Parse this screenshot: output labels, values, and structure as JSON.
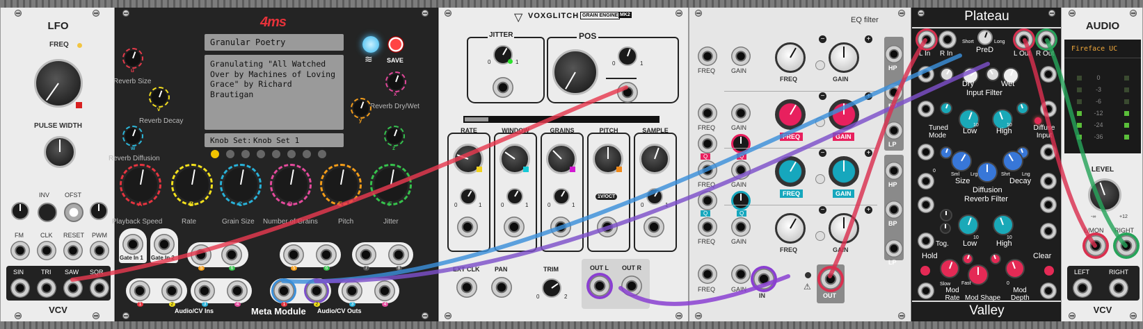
{
  "lfo": {
    "title": "LFO",
    "freq": "FREQ",
    "pulse_width": "PULSE WIDTH",
    "inv": "INV",
    "ofst": "OFST",
    "fm": "FM",
    "clk": "CLK",
    "reset": "RESET",
    "pwm": "PWM",
    "sin": "SIN",
    "tri": "TRI",
    "saw": "SAW",
    "sqr": "SQR",
    "brand": "VCV"
  },
  "metamodule": {
    "logo": "4ms",
    "save": "SAVE",
    "patch_name": "Granular Poetry",
    "description": "Granulating \"All Watched Over by Machines of Loving Grace\" by Richard Brautigan",
    "knobset_label": "Knob Set:",
    "knobset_value": "Knob Set 1",
    "small_knobs": [
      {
        "letter": "u",
        "name": "Reverb Size",
        "color": "#e43a4a"
      },
      {
        "letter": "v",
        "name": "Reverb Decay",
        "color": "#f1dc1e"
      },
      {
        "letter": "w",
        "name": "Reverb Diffusion",
        "color": "#2cb6d9"
      },
      {
        "letter": "x",
        "name": "Reverb Dry/Wet",
        "color": "#e0479a"
      },
      {
        "letter": "y",
        "name": "",
        "color": "#f39c1a"
      },
      {
        "letter": "z",
        "name": "",
        "color": "#35c04e"
      }
    ],
    "big_knobs": [
      {
        "letter": "A",
        "name": "Playback Speed",
        "color": "#e4343f"
      },
      {
        "letter": "B",
        "name": "Rate",
        "color": "#f2e01c"
      },
      {
        "letter": "C",
        "name": "Grain Size",
        "color": "#28b1d8"
      },
      {
        "letter": "D",
        "name": "Number of Grains",
        "color": "#e44a9c"
      },
      {
        "letter": "E",
        "name": "Pitch",
        "color": "#f39c18"
      },
      {
        "letter": "F",
        "name": "Jitter",
        "color": "#36c24c"
      }
    ],
    "gate_in_1": "Gate In 1",
    "gate_in_2": "Gate In 2",
    "audio_cv_ins": "Audio/CV Ins",
    "audio_cv_outs": "Audio/CV Outs",
    "title": "Meta Module",
    "jack_numbers": [
      "1",
      "2",
      "3",
      "4",
      "5",
      "6",
      "7",
      "8"
    ]
  },
  "grain": {
    "brand": "VOXGLITCH",
    "brand_tag": "GRAIN ENGINE",
    "brand_ver": "MK2",
    "jitter": "JITTER",
    "pos": "POS",
    "zero": "0",
    "one": "1",
    "two": "2",
    "rate": "RATE",
    "window": "WINDOW",
    "grains": "GRAINS",
    "pitch": "PITCH",
    "sample": "SAMPLE",
    "voct": "1V/OCT",
    "ext_clk": "EXT CLK",
    "pan": "PAN",
    "trim": "TRIM",
    "out_l": "OUT L",
    "out_r": "OUT R"
  },
  "eq": {
    "title": "EQ filter",
    "freq": "FREQ",
    "gain": "GAIN",
    "q": "Q",
    "in": "IN",
    "out": "OUT",
    "minus": "−",
    "plus": "+",
    "hp": "HP",
    "bp": "BP",
    "lp": "LP",
    "pink": "#e8205e",
    "teal": "#16a7bd"
  },
  "plateau": {
    "title": "Plateau",
    "brand": "Valley",
    "l_in": "L In",
    "r_in": "R In",
    "short": "Short",
    "long": "Long",
    "pred": "PreD",
    "l_out": "L Out",
    "r_out": "R Out",
    "dry": "Dry",
    "wet": "Wet",
    "input_filter": "Input Filter",
    "tuned_mode": "Tuned Mode",
    "low": "Low",
    "high": "High",
    "diffuse_input": "Diffuse Input",
    "size": "Size",
    "sml": "Sml",
    "lrg": "Lrg",
    "shrt": "Shrt",
    "lng": "Lng",
    "decay": "Decay",
    "diffusion": "Diffusion",
    "reverb_filter": "Reverb Filter",
    "tog": "Tog.",
    "hold": "Hold",
    "clear": "Clear",
    "slow": "Slow",
    "fast": "Fast",
    "mod_rate": "Mod Rate",
    "mod_shape": "Mod Shape",
    "mod_depth": "Mod Depth",
    "ten": "10",
    "zero": "0"
  },
  "audio": {
    "title": "AUDIO",
    "device": "Fireface UC",
    "meter_labels": [
      "0",
      "-3",
      "-6",
      "-12",
      "-24",
      "-36"
    ],
    "level": "LEVEL",
    "min": "-∞",
    "max": "+12",
    "lmon": "L/MON",
    "right": "RIGHT",
    "left": "LEFT",
    "right2": "RIGHT",
    "brand": "VCV"
  }
}
